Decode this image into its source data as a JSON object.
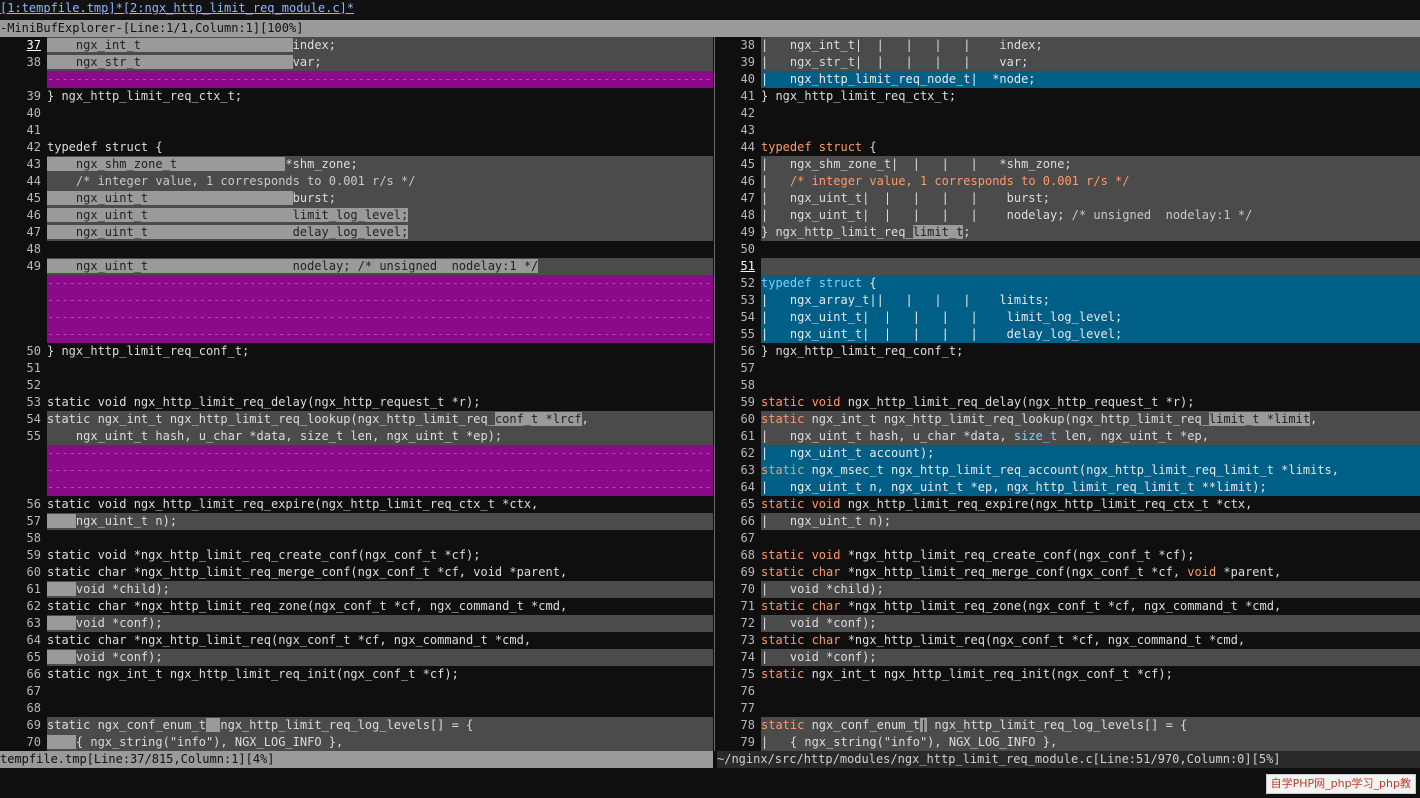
{
  "tabline": "[1:tempfile.tmp]*[2:ngx_http_limit_req_module.c]*",
  "minibuf": "-MiniBufExplorer-[Line:1/1,Column:1][100%]",
  "status_left": "tempfile.tmp[Line:37/815,Column:1][4%]",
  "status_right": "~/nginx/src/http/modules/ngx_http_limit_req_module.c[Line:51/970,Column:0][5%]",
  "watermark": "自学PHP网_php学习_php教",
  "left_lines": [
    {
      "n": "37",
      "t": "change",
      "cur": true,
      "s": [
        [
          "chg",
          "    ngx_int_t                     "
        ],
        [
          "",
          "index;"
        ]
      ]
    },
    {
      "n": "38",
      "t": "change",
      "s": [
        [
          "chg",
          "    ngx_str_t                     "
        ],
        [
          "",
          "var;"
        ]
      ]
    },
    {
      "n": "",
      "t": "filler",
      "s": [
        [
          "",
          "--------------------------------------------------------------------------------------------------------"
        ]
      ]
    },
    {
      "n": "39",
      "t": "",
      "s": [
        [
          "",
          "} ngx_http_limit_req_ctx_t;"
        ]
      ]
    },
    {
      "n": "40",
      "t": "",
      "s": []
    },
    {
      "n": "41",
      "t": "",
      "s": []
    },
    {
      "n": "42",
      "t": "",
      "s": [
        [
          "",
          "typedef struct {"
        ]
      ]
    },
    {
      "n": "43",
      "t": "change",
      "s": [
        [
          "chg",
          "    ngx_shm_zone_t               "
        ],
        [
          "",
          "*shm_zone;"
        ]
      ]
    },
    {
      "n": "44",
      "t": "change",
      "s": [
        [
          "cm",
          "    /* integer value, 1 corresponds to 0.001 r/s */"
        ]
      ]
    },
    {
      "n": "45",
      "t": "change",
      "s": [
        [
          "chg",
          "    ngx_uint_t                    "
        ],
        [
          "",
          "burst;"
        ]
      ]
    },
    {
      "n": "46",
      "t": "change",
      "s": [
        [
          "chg",
          "    ngx_uint_t                    limit_log_level;"
        ]
      ]
    },
    {
      "n": "47",
      "t": "change",
      "s": [
        [
          "chg",
          "    ngx_uint_t                    delay_log_level;"
        ]
      ]
    },
    {
      "n": "48",
      "t": "",
      "s": []
    },
    {
      "n": "49",
      "t": "change",
      "s": [
        [
          "chg",
          "    ngx_uint_t                    nodelay; /* unsigned  nodelay:1 */"
        ]
      ]
    },
    {
      "n": "",
      "t": "filler",
      "s": [
        [
          "",
          "--------------------------------------------------------------------------------------------------------"
        ]
      ]
    },
    {
      "n": "",
      "t": "filler",
      "s": [
        [
          "",
          "--------------------------------------------------------------------------------------------------------"
        ]
      ]
    },
    {
      "n": "",
      "t": "filler",
      "s": [
        [
          "",
          "--------------------------------------------------------------------------------------------------------"
        ]
      ]
    },
    {
      "n": "",
      "t": "filler",
      "s": [
        [
          "",
          "--------------------------------------------------------------------------------------------------------"
        ]
      ]
    },
    {
      "n": "50",
      "t": "",
      "s": [
        [
          "",
          "} ngx_http_limit_req_conf_t;"
        ]
      ]
    },
    {
      "n": "51",
      "t": "",
      "s": []
    },
    {
      "n": "52",
      "t": "",
      "s": []
    },
    {
      "n": "53",
      "t": "",
      "s": [
        [
          "",
          "static void ngx_http_limit_req_delay(ngx_http_request_t *r);"
        ]
      ]
    },
    {
      "n": "54",
      "t": "change",
      "s": [
        [
          "",
          "static ngx_int_t ngx_http_limit_req_lookup(ngx_http_limit_req_"
        ],
        [
          "chg",
          "conf_t *lrcf"
        ],
        [
          "",
          ","
        ]
      ]
    },
    {
      "n": "55",
      "t": "change",
      "s": [
        [
          "",
          "    ngx_uint_t hash, u_char *data, size_t len, ngx_uint_t *ep);"
        ]
      ]
    },
    {
      "n": "",
      "t": "filler",
      "s": [
        [
          "",
          "--------------------------------------------------------------------------------------------------------"
        ]
      ]
    },
    {
      "n": "",
      "t": "filler",
      "s": [
        [
          "",
          "--------------------------------------------------------------------------------------------------------"
        ]
      ]
    },
    {
      "n": "",
      "t": "filler",
      "s": [
        [
          "",
          "--------------------------------------------------------------------------------------------------------"
        ]
      ]
    },
    {
      "n": "56",
      "t": "",
      "s": [
        [
          "",
          "static void ngx_http_limit_req_expire(ngx_http_limit_req_ctx_t *ctx,"
        ]
      ]
    },
    {
      "n": "57",
      "t": "change",
      "s": [
        [
          "chg",
          "    "
        ],
        [
          "",
          "ngx_uint_t n);"
        ]
      ]
    },
    {
      "n": "58",
      "t": "",
      "s": []
    },
    {
      "n": "59",
      "t": "",
      "s": [
        [
          "",
          "static void *ngx_http_limit_req_create_conf(ngx_conf_t *cf);"
        ]
      ]
    },
    {
      "n": "60",
      "t": "",
      "s": [
        [
          "",
          "static char *ngx_http_limit_req_merge_conf(ngx_conf_t *cf, void *parent,"
        ]
      ]
    },
    {
      "n": "61",
      "t": "change",
      "s": [
        [
          "chg",
          "    "
        ],
        [
          "",
          "void *child);"
        ]
      ]
    },
    {
      "n": "62",
      "t": "",
      "s": [
        [
          "",
          "static char *ngx_http_limit_req_zone(ngx_conf_t *cf, ngx_command_t *cmd,"
        ]
      ]
    },
    {
      "n": "63",
      "t": "change",
      "s": [
        [
          "chg",
          "    "
        ],
        [
          "",
          "void *conf);"
        ]
      ]
    },
    {
      "n": "64",
      "t": "",
      "s": [
        [
          "",
          "static char *ngx_http_limit_req(ngx_conf_t *cf, ngx_command_t *cmd,"
        ]
      ]
    },
    {
      "n": "65",
      "t": "change",
      "s": [
        [
          "chg",
          "    "
        ],
        [
          "",
          "void *conf);"
        ]
      ]
    },
    {
      "n": "66",
      "t": "",
      "s": [
        [
          "",
          "static ngx_int_t ngx_http_limit_req_init(ngx_conf_t *cf);"
        ]
      ]
    },
    {
      "n": "67",
      "t": "",
      "s": []
    },
    {
      "n": "68",
      "t": "",
      "s": []
    },
    {
      "n": "69",
      "t": "change",
      "s": [
        [
          "",
          "static ngx_conf_enum_t"
        ],
        [
          "chg",
          "  "
        ],
        [
          "",
          "ngx_http_limit_req_log_levels[] = {"
        ]
      ]
    },
    {
      "n": "70",
      "t": "change",
      "s": [
        [
          "chg",
          "    "
        ],
        [
          "",
          "{ ngx_string(\"info\"), NGX_LOG_INFO },"
        ]
      ]
    }
  ],
  "right_lines": [
    {
      "n": "38",
      "t": "change",
      "s": [
        [
          "",
          "|   ngx_int_t|  |   |   |   |    index;"
        ]
      ]
    },
    {
      "n": "39",
      "t": "change",
      "s": [
        [
          "",
          "|   ngx_str_t|  |   |   |   |    var;"
        ]
      ]
    },
    {
      "n": "40",
      "t": "add",
      "s": [
        [
          "",
          "|   ngx_http_limit_req_node_t|  *node;"
        ]
      ]
    },
    {
      "n": "41",
      "t": "",
      "s": [
        [
          "",
          "} ngx_http_limit_req_ctx_t;"
        ]
      ]
    },
    {
      "n": "42",
      "t": "",
      "s": []
    },
    {
      "n": "43",
      "t": "",
      "s": []
    },
    {
      "n": "44",
      "t": "",
      "s": [
        [
          "kw",
          "typedef struct"
        ],
        [
          "",
          " {"
        ]
      ]
    },
    {
      "n": "45",
      "t": "change",
      "s": [
        [
          "",
          "|   ngx_shm_zone_t|  |   |   |   *shm_zone;"
        ]
      ]
    },
    {
      "n": "46",
      "t": "change",
      "s": [
        [
          "",
          "|   "
        ],
        [
          "kw",
          "/* integer value, 1 corresponds to 0.001 r/s */"
        ]
      ]
    },
    {
      "n": "47",
      "t": "change",
      "s": [
        [
          "",
          "|   ngx_uint_t|  |   |   |   |    burst;"
        ]
      ]
    },
    {
      "n": "48",
      "t": "change",
      "s": [
        [
          "",
          "|   ngx_uint_t|  |   |   |   |    nodelay; "
        ],
        [
          "cm",
          "/* unsigned  nodelay:1 */"
        ]
      ]
    },
    {
      "n": "49",
      "t": "change",
      "s": [
        [
          "",
          "} ngx_http_limit_req_"
        ],
        [
          "chg",
          "limit_t"
        ],
        [
          "",
          ";"
        ]
      ]
    },
    {
      "n": "50",
      "t": "",
      "s": []
    },
    {
      "n": "51",
      "t": "change",
      "cur": true,
      "s": []
    },
    {
      "n": "52",
      "t": "add",
      "s": [
        [
          "ty",
          "typedef struct"
        ],
        [
          "",
          " {"
        ]
      ]
    },
    {
      "n": "53",
      "t": "add",
      "s": [
        [
          "",
          "|   ngx_array_t||   |   |   |    limits;"
        ]
      ]
    },
    {
      "n": "54",
      "t": "add",
      "s": [
        [
          "",
          "|   ngx_uint_t|  |   |   |   |    limit_log_level;"
        ]
      ]
    },
    {
      "n": "55",
      "t": "add",
      "s": [
        [
          "",
          "|   ngx_uint_t|  |   |   |   |    delay_log_level;"
        ]
      ]
    },
    {
      "n": "56",
      "t": "",
      "s": [
        [
          "",
          "} ngx_http_limit_req_conf_t;"
        ]
      ]
    },
    {
      "n": "57",
      "t": "",
      "s": []
    },
    {
      "n": "58",
      "t": "",
      "s": []
    },
    {
      "n": "59",
      "t": "",
      "s": [
        [
          "kw",
          "static void"
        ],
        [
          "",
          " ngx_http_limit_req_delay(ngx_http_request_t *r);"
        ]
      ]
    },
    {
      "n": "60",
      "t": "change",
      "s": [
        [
          "kw",
          "static"
        ],
        [
          "",
          " ngx_int_t ngx_http_limit_req_lookup(ngx_http_limit_req_"
        ],
        [
          "chg",
          "limit_t *limit"
        ],
        [
          "",
          ","
        ]
      ]
    },
    {
      "n": "61",
      "t": "change",
      "s": [
        [
          "",
          "|   ngx_uint_t hash, u_char *data, "
        ],
        [
          "ty",
          "size_t"
        ],
        [
          "",
          " len, ngx_uint_t *ep,"
        ]
      ]
    },
    {
      "n": "62",
      "t": "add",
      "s": [
        [
          "",
          "|   ngx_uint_t account);"
        ]
      ]
    },
    {
      "n": "63",
      "t": "add",
      "s": [
        [
          "kw",
          "static"
        ],
        [
          "",
          " ngx_msec_t ngx_http_limit_req_account(ngx_http_limit_req_limit_t *limits,"
        ]
      ]
    },
    {
      "n": "64",
      "t": "add",
      "s": [
        [
          "",
          "|   ngx_uint_t n, ngx_uint_t *ep, ngx_http_limit_req_limit_t **limit);"
        ]
      ]
    },
    {
      "n": "65",
      "t": "",
      "s": [
        [
          "kw",
          "static void"
        ],
        [
          "",
          " ngx_http_limit_req_expire(ngx_http_limit_req_ctx_t *ctx,"
        ]
      ]
    },
    {
      "n": "66",
      "t": "change",
      "s": [
        [
          "",
          "|   ngx_uint_t n);"
        ]
      ]
    },
    {
      "n": "67",
      "t": "",
      "s": []
    },
    {
      "n": "68",
      "t": "",
      "s": [
        [
          "kw",
          "static void"
        ],
        [
          "",
          " *ngx_http_limit_req_create_conf(ngx_conf_t *cf);"
        ]
      ]
    },
    {
      "n": "69",
      "t": "",
      "s": [
        [
          "kw",
          "static char"
        ],
        [
          "",
          " *ngx_http_limit_req_merge_conf(ngx_conf_t *cf, "
        ],
        [
          "kw",
          "void"
        ],
        [
          "",
          " *parent,"
        ]
      ]
    },
    {
      "n": "70",
      "t": "change",
      "s": [
        [
          "",
          "|   void *child);"
        ]
      ]
    },
    {
      "n": "71",
      "t": "",
      "s": [
        [
          "kw",
          "static char"
        ],
        [
          "",
          " *ngx_http_limit_req_zone(ngx_conf_t *cf, ngx_command_t *cmd,"
        ]
      ]
    },
    {
      "n": "72",
      "t": "change",
      "s": [
        [
          "",
          "|   void *conf);"
        ]
      ]
    },
    {
      "n": "73",
      "t": "",
      "s": [
        [
          "kw",
          "static char"
        ],
        [
          "",
          " *ngx_http_limit_req(ngx_conf_t *cf, ngx_command_t *cmd,"
        ]
      ]
    },
    {
      "n": "74",
      "t": "change",
      "s": [
        [
          "",
          "|   void *conf);"
        ]
      ]
    },
    {
      "n": "75",
      "t": "",
      "s": [
        [
          "kw",
          "static"
        ],
        [
          "",
          " ngx_int_t ngx_http_limit_req_init(ngx_conf_t *cf);"
        ]
      ]
    },
    {
      "n": "76",
      "t": "",
      "s": []
    },
    {
      "n": "77",
      "t": "",
      "s": []
    },
    {
      "n": "78",
      "t": "change",
      "s": [
        [
          "kw",
          "static"
        ],
        [
          "",
          " ngx_conf_enum_t"
        ],
        [
          "chg",
          "|"
        ],
        [
          "",
          " ngx_http_limit_req_log_levels[] = {"
        ]
      ]
    },
    {
      "n": "79",
      "t": "change",
      "s": [
        [
          "",
          "|   { ngx_string(\"info\"), NGX_LOG_INFO },"
        ]
      ]
    }
  ]
}
